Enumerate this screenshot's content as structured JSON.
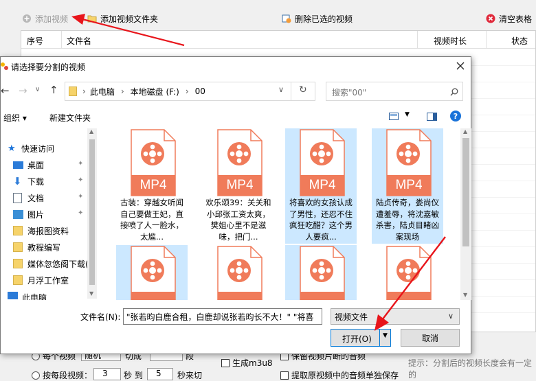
{
  "toolbar": {
    "add_video": "添加视频",
    "add_folder": "添加视频文件夹",
    "delete_selected": "删除已选的视频",
    "clear_table": "清空表格"
  },
  "table": {
    "columns": [
      "序号",
      "文件名",
      "视频时长",
      "状态"
    ]
  },
  "bottom": {
    "opt_each_video": "每个视频",
    "sel_mode": "随机",
    "lbl_split": "切成",
    "lbl_segments": "段",
    "opt_by_segment": "按每段视频：",
    "seg_from": "3",
    "lbl_sec_to": "秒 到",
    "seg_to": "5",
    "lbl_sec_unit": "秒来切",
    "chk_m3u8": "生成m3u8",
    "chk_keep": "保留视频片断的音频",
    "chk_extract": "提取原视频中的音频单独保存",
    "hint": "提示：分割后的视频长度会有一定的"
  },
  "dialog": {
    "title": "请选择要分割的视频",
    "breadcrumb": [
      "此电脑",
      "本地磁盘 (F:)",
      "00"
    ],
    "search_placeholder": "搜索\"00\"",
    "organize": "组织 ▾",
    "new_folder": "新建文件夹",
    "nav": [
      {
        "label": "快速访问",
        "icon": "star-icon"
      },
      {
        "label": "桌面",
        "icon": "desktop-icon"
      },
      {
        "label": "下载",
        "icon": "download-icon"
      },
      {
        "label": "文档",
        "icon": "document-icon"
      },
      {
        "label": "图片",
        "icon": "picture-icon"
      },
      {
        "label": "海报图资料",
        "icon": "folder-icon"
      },
      {
        "label": "教程编写",
        "icon": "folder-icon"
      },
      {
        "label": "媒体忽悠阁下载(",
        "icon": "folder-icon"
      },
      {
        "label": "月浮工作室",
        "icon": "folder-icon"
      },
      {
        "label": "此电脑",
        "icon": "computer-icon"
      }
    ],
    "files": [
      {
        "badge": "MP4",
        "caption": "古装：穿越女听闻自己要做王妃，直接喷了人一脸水，太尴...",
        "selected": false
      },
      {
        "badge": "MP4",
        "caption": "欢乐颂39：关关和小邱张工资太爽，樊姐心里不是滋味，把门...",
        "selected": false
      },
      {
        "badge": "MP4",
        "caption": "将喜欢的女孩认成了男性，还忍不住疯狂吃醋？这个男人要疯...",
        "selected": true
      },
      {
        "badge": "MP4",
        "caption": "陆贞传奇，娄尚仪遭羞辱，将沈嘉敏杀害，陆贞目睹凶案现场",
        "selected": true
      },
      {
        "badge": "",
        "caption": "",
        "selected": true
      },
      {
        "badge": "",
        "caption": "",
        "selected": false
      },
      {
        "badge": "",
        "caption": "",
        "selected": true
      },
      {
        "badge": "",
        "caption": "",
        "selected": false
      }
    ],
    "filename_label": "文件名(N):",
    "filename_value": "\"张若昀白鹿合租，白鹿却说张若昀长不大！\" \"将喜",
    "filetype": "视频文件",
    "open": "打开(O)",
    "cancel": "取消"
  },
  "colors": {
    "accent": "#0078d7",
    "selection": "#cce8ff",
    "mp4_orange": "#f07b5a",
    "arrow_red": "#e8151b"
  }
}
